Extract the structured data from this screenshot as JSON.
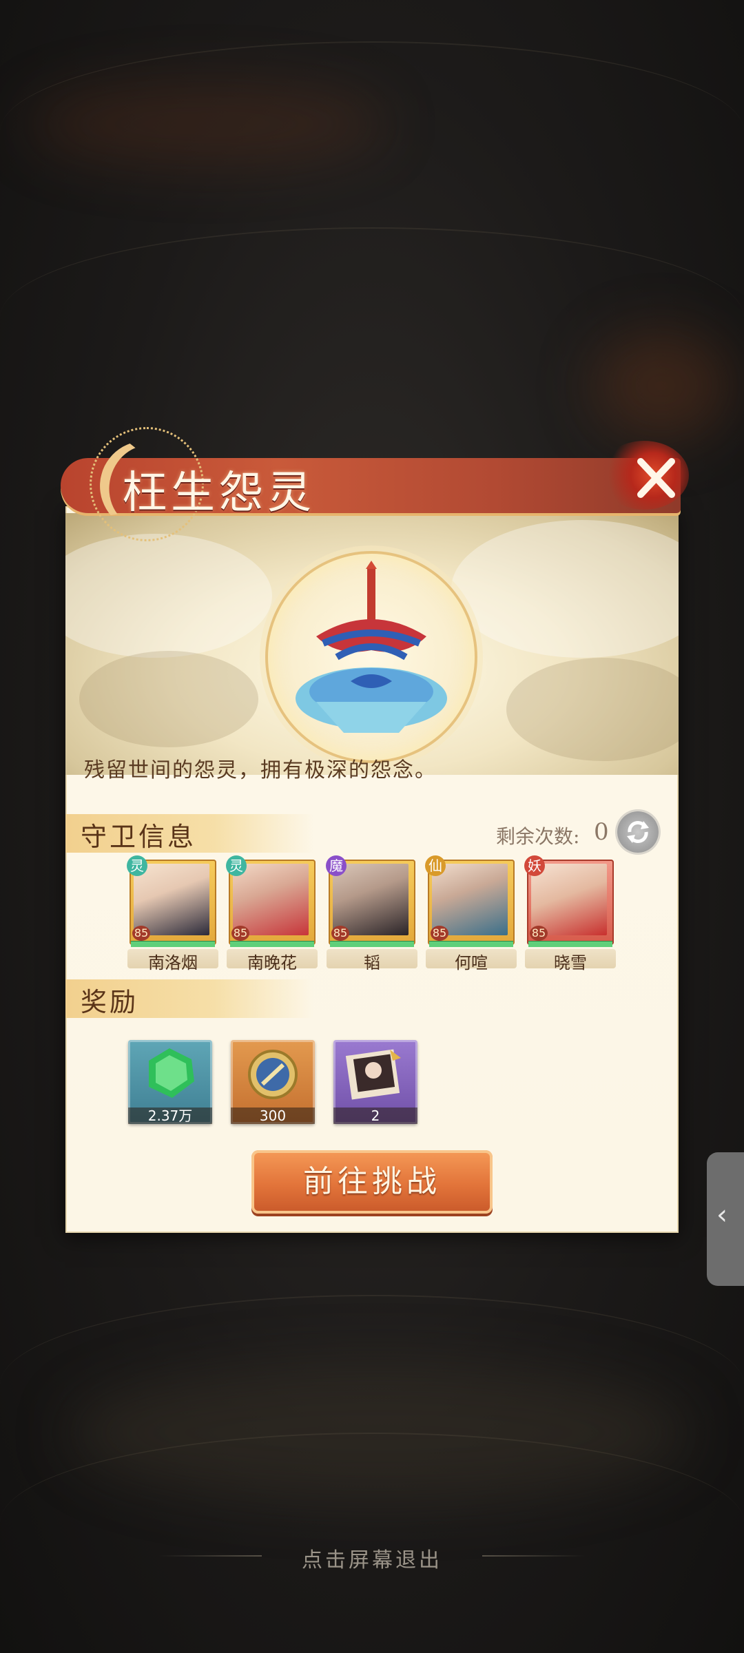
{
  "dialog": {
    "title": "枉生怨灵",
    "description": "残留世间的怨灵，拥有极深的怨念。",
    "close_icon": "close-x-icon"
  },
  "guards": {
    "section_label": "守卫信息",
    "remaining_label": "剩余次数:",
    "remaining_count": "0",
    "heroes": [
      {
        "name": "南洛烟",
        "level": "85",
        "faction": "灵",
        "badge_color": "#3fb6a0"
      },
      {
        "name": "南晚花",
        "level": "85",
        "faction": "灵",
        "badge_color": "#3fb6a0"
      },
      {
        "name": "韬",
        "level": "85",
        "faction": "魔",
        "badge_color": "#8a4fc9"
      },
      {
        "name": "何喧",
        "level": "85",
        "faction": "仙",
        "badge_color": "#d99a2a"
      },
      {
        "name": "晓雪",
        "level": "85",
        "faction": "妖",
        "badge_color": "#d2493a"
      }
    ]
  },
  "rewards": {
    "section_label": "奖励",
    "items": [
      {
        "icon": "green-jade-icon",
        "count": "2.37万"
      },
      {
        "icon": "gold-coin-icon",
        "count": "300"
      },
      {
        "icon": "portrait-card-icon",
        "count": "2"
      }
    ]
  },
  "actions": {
    "challenge_label": "前往挑战",
    "exit_hint": "点击屏幕退出",
    "side_tab_icon": "chevron-left-icon"
  }
}
